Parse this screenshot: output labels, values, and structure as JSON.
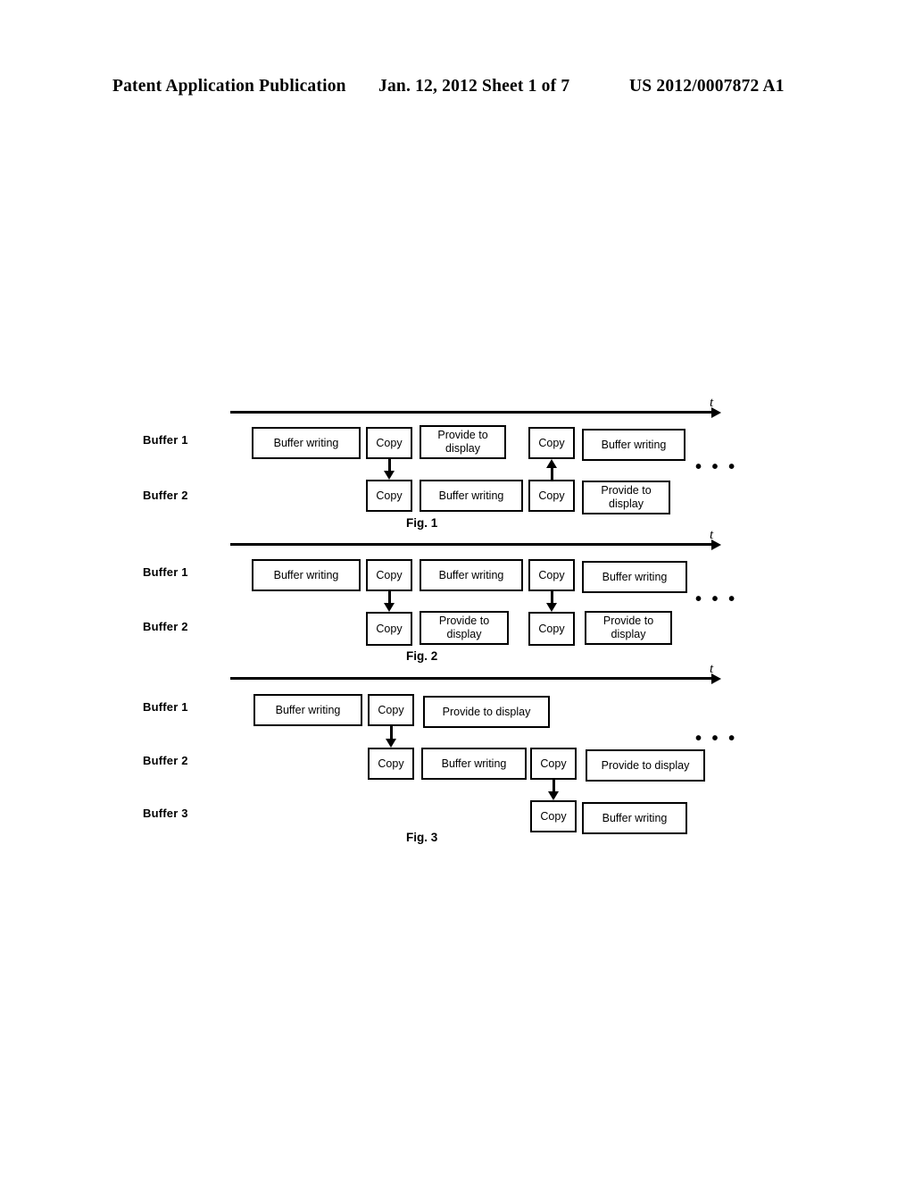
{
  "header": {
    "title": "Patent Application Publication",
    "date_sheet": "Jan. 12, 2012  Sheet 1 of 7",
    "publication_number": "US 2012/0007872 A1"
  },
  "labels": {
    "buffer1": "Buffer 1",
    "buffer2": "Buffer 2",
    "buffer3": "Buffer 3",
    "time_axis": "t",
    "ellipsis": "• • •"
  },
  "figures": [
    {
      "caption": "Fig. 1",
      "rows": [
        {
          "label": "Buffer 1",
          "blocks": [
            {
              "text": "Buffer writing",
              "lines": 1
            },
            {
              "text": "Copy",
              "lines": 1
            },
            {
              "text": "Provide to display",
              "lines": 2
            },
            {
              "text": "Copy",
              "lines": 1
            },
            {
              "text": "Buffer writing",
              "lines": 1
            }
          ]
        },
        {
          "label": "Buffer 2",
          "blocks": [
            {
              "text": "Copy",
              "lines": 1
            },
            {
              "text": "Buffer writing",
              "lines": 1
            },
            {
              "text": "Copy",
              "lines": 1
            },
            {
              "text": "Provide to display",
              "lines": 2
            }
          ]
        }
      ],
      "arrows": [
        {
          "direction": "down",
          "from": "Buffer 1 Copy",
          "to": "Buffer 2 Copy"
        },
        {
          "direction": "up",
          "from": "Buffer 2 Copy",
          "to": "Buffer 1 Copy"
        }
      ]
    },
    {
      "caption": "Fig. 2",
      "rows": [
        {
          "label": "Buffer 1",
          "blocks": [
            {
              "text": "Buffer writing",
              "lines": 1
            },
            {
              "text": "Copy",
              "lines": 1
            },
            {
              "text": "Buffer writing",
              "lines": 1
            },
            {
              "text": "Copy",
              "lines": 1
            },
            {
              "text": "Buffer writing",
              "lines": 1
            }
          ]
        },
        {
          "label": "Buffer 2",
          "blocks": [
            {
              "text": "Copy",
              "lines": 1
            },
            {
              "text": "Provide to display",
              "lines": 2
            },
            {
              "text": "Copy",
              "lines": 1
            },
            {
              "text": "Provide to display",
              "lines": 2
            }
          ]
        }
      ],
      "arrows": [
        {
          "direction": "down",
          "from": "Buffer 1 Copy",
          "to": "Buffer 2 Copy"
        },
        {
          "direction": "down",
          "from": "Buffer 1 Copy",
          "to": "Buffer 2 Copy"
        }
      ]
    },
    {
      "caption": "Fig. 3",
      "rows": [
        {
          "label": "Buffer 1",
          "blocks": [
            {
              "text": "Buffer writing",
              "lines": 1
            },
            {
              "text": "Copy",
              "lines": 1
            },
            {
              "text": "Provide to display",
              "lines": 1
            }
          ]
        },
        {
          "label": "Buffer 2",
          "blocks": [
            {
              "text": "Copy",
              "lines": 1
            },
            {
              "text": "Buffer writing",
              "lines": 1
            },
            {
              "text": "Copy",
              "lines": 1
            },
            {
              "text": "Provide to display",
              "lines": 1
            }
          ]
        },
        {
          "label": "Buffer 3",
          "blocks": [
            {
              "text": "Copy",
              "lines": 1
            },
            {
              "text": "Buffer writing",
              "lines": 1
            }
          ]
        }
      ],
      "arrows": [
        {
          "direction": "down",
          "from": "Buffer 1 Copy",
          "to": "Buffer 2 Copy"
        },
        {
          "direction": "down",
          "from": "Buffer 2 Copy",
          "to": "Buffer 3 Copy"
        }
      ]
    }
  ]
}
